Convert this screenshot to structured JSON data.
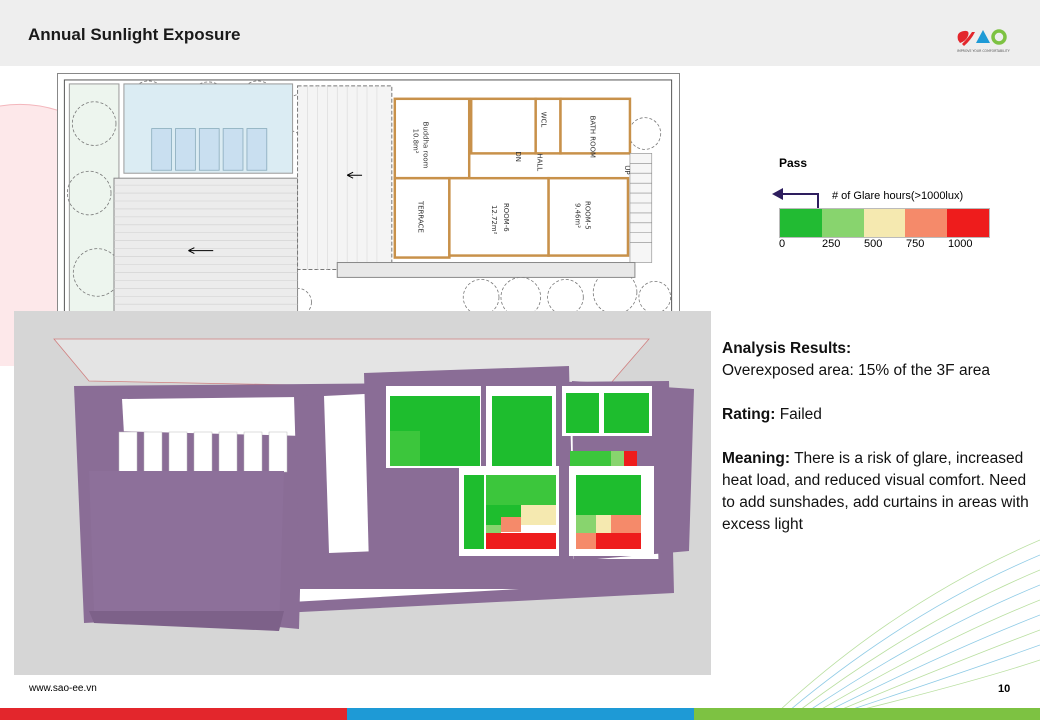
{
  "header": {
    "title": "Annual Sunlight Exposure",
    "logo_text": "SAO",
    "logo_tagline": "IMPROVE YOUR COMFORTABILITY"
  },
  "floor_plan": {
    "labels": {
      "buddha_room": "Buddha room",
      "buddha_area": "10.8m²",
      "terrace": "TERRACE",
      "wcl": "WCL",
      "bathroom": "BATH ROOM",
      "hall": "HALL",
      "dn": "DN",
      "up": "UP",
      "room6": "ROOM-6",
      "room6_area": "12.72m²",
      "room5": "ROOM-5",
      "room5_area": "9.46m²"
    }
  },
  "legend": {
    "pass_label": "Pass",
    "title": "# of Glare hours(>1000lux)",
    "colors": [
      "#22bb33",
      "#88d46e",
      "#f5e9b0",
      "#f58a6a",
      "#ee1c1c"
    ],
    "ticks": [
      "0",
      "250",
      "500",
      "750",
      "1000"
    ]
  },
  "results": {
    "heading": "Analysis Results:",
    "overexposed": "Overexposed area: 15% of the 3F area",
    "rating_label": "Rating:",
    "rating_value": "Failed",
    "meaning_label": "Meaning:",
    "meaning_text": "There is a risk of glare, increased heat load, and reduced visual comfort. Need to add sunshades, add curtains in areas with excess light"
  },
  "footer": {
    "url": "www.sao-ee.vn",
    "page_number": "10"
  },
  "colors": {
    "bar_red": "#e3262c",
    "bar_blue": "#1e9ad6",
    "bar_green": "#7dc242",
    "render_purple": "#8a6d96"
  }
}
